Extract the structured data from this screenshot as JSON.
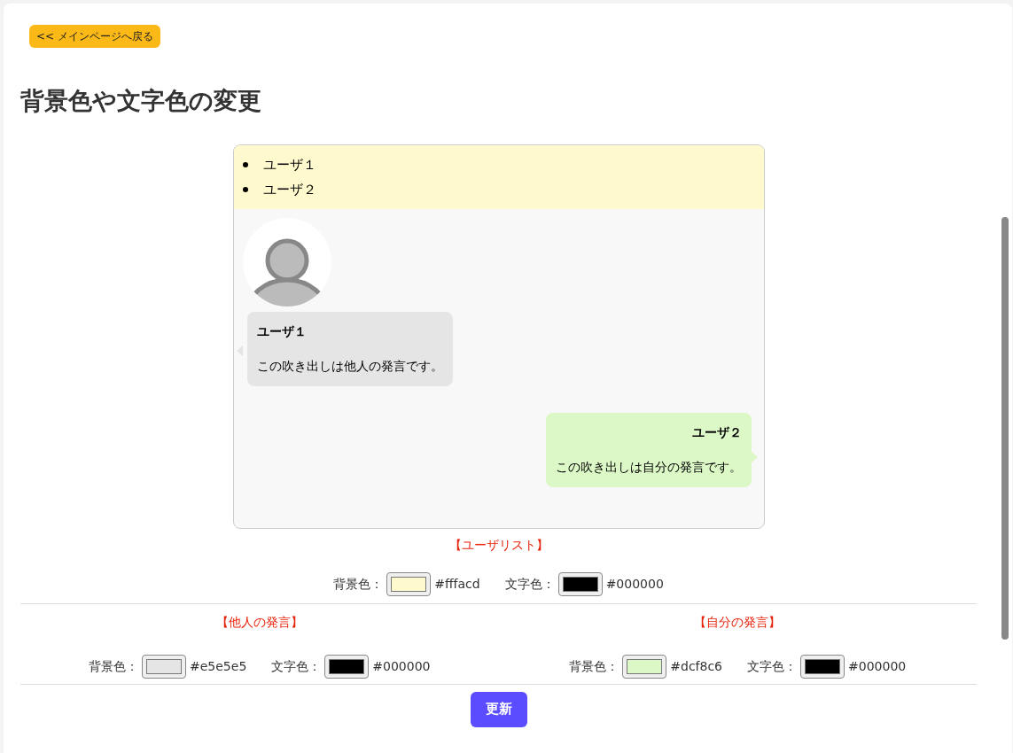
{
  "back_button": "<< メインページへ戻る",
  "heading": "背景色や文字色の変更",
  "preview": {
    "users": [
      "ユーザ１",
      "ユーザ２"
    ],
    "messages": [
      {
        "kind": "other",
        "name": "ユーザ１",
        "text": "この吹き出しは他人の発言です。"
      },
      {
        "kind": "self",
        "name": "ユーザ２",
        "text": "この吹き出しは自分の発言です。"
      }
    ]
  },
  "sections": [
    {
      "title": "【ユーザリスト】",
      "pickers": [
        {
          "label": "背景色：",
          "value": "#fffacd"
        },
        {
          "label": "文字色：",
          "value": "#000000"
        }
      ]
    },
    {
      "title": "【他人の発言】",
      "pickers": [
        {
          "label": "背景色：",
          "value": "#e5e5e5"
        },
        {
          "label": "文字色：",
          "value": "#000000"
        }
      ]
    },
    {
      "title": "【自分の発言】",
      "pickers": [
        {
          "label": "背景色：",
          "value": "#dcf8c6"
        },
        {
          "label": "文字色：",
          "value": "#000000"
        }
      ]
    }
  ],
  "update_button": "更新"
}
